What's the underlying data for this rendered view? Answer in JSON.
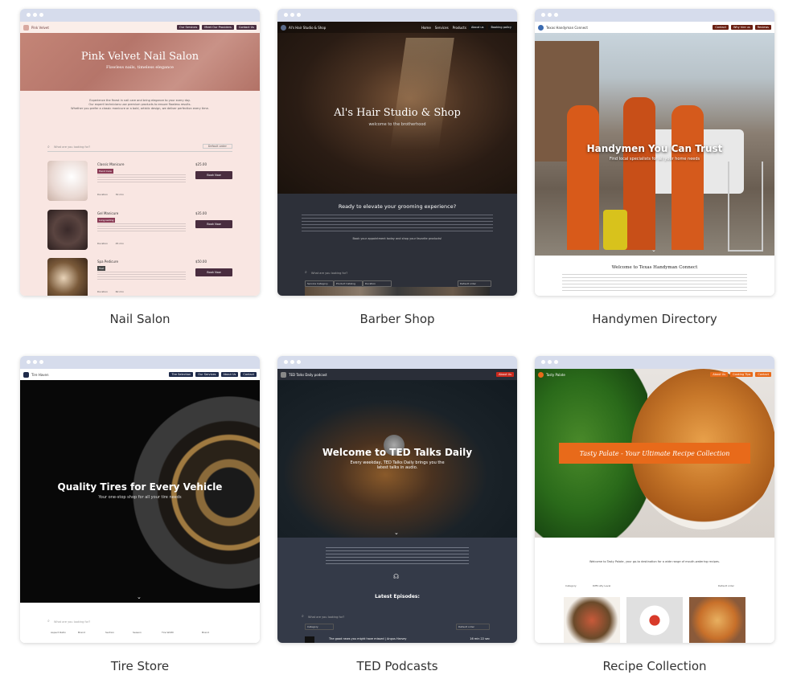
{
  "cards": [
    {
      "caption": "Nail Salon",
      "brand": "Pink Velvet",
      "nav": [
        "Our Services",
        "Meet Our Providers",
        "Contact Us"
      ],
      "hero_title": "Pink Velvet Nail Salon",
      "hero_subtitle": "Flawless nails, timeless elegance",
      "intro": [
        "Experience the finest in nail care and bring elegance to your every day.",
        "Our expert technicians use premium products to ensure flawless results.",
        "Whether you prefer a classic manicure or a bold, artistic design, we deliver perfection every time."
      ],
      "search_placeholder": "What are you looking for?",
      "sort_label": "Default order",
      "services": [
        {
          "name": "Classic Manicure",
          "tag": "Hand Care",
          "price": "$25.00",
          "duration_label": "Duration",
          "duration": "30 min",
          "cta": "Book Now"
        },
        {
          "name": "Gel Manicure",
          "tag": "Long-lasting",
          "price": "$35.00",
          "duration_label": "Duration",
          "duration": "45 min",
          "cta": "Book Now"
        },
        {
          "name": "Spa Pedicure",
          "tag": "Feet",
          "price": "$50.00",
          "duration_label": "Duration",
          "duration": "60 min",
          "cta": "Book Now"
        }
      ]
    },
    {
      "caption": "Barber Shop",
      "brand": "Al's Hair Studio & Shop",
      "nav": [
        "Home",
        "Services",
        "Products",
        "About us"
      ],
      "nav_cta": "Booking policy",
      "hero_title": "Al's Hair Studio & Shop",
      "hero_subtitle": "welcome to the brotherhood",
      "section_title": "Ready to elevate your grooming experience?",
      "section_sub": "Book your appointment today and shop your favorite products!",
      "search_placeholder": "What are you looking for?",
      "filters": [
        "Service Category",
        "Product Catalog",
        "Duration"
      ],
      "sort_label": "Default order"
    },
    {
      "caption": "Handymen Directory",
      "brand": "Texas Handyman Connect",
      "nav": [
        "Contact",
        "Why hire us",
        "Reviews"
      ],
      "nav_cta": "Find help now",
      "hero_title": "Handymen You Can Trust",
      "hero_subtitle": "Find local specialists for all your home needs",
      "section_title": "Welcome to Texas Handyman Connect"
    },
    {
      "caption": "Tire Store",
      "brand": "Tire Haven",
      "nav": [
        "Tire Selection",
        "Our Services",
        "About Us",
        "Contact"
      ],
      "hero_title": "Quality Tires for Every Vehicle",
      "hero_subtitle": "Your one-stop shop for all your tire needs",
      "search_placeholder": "What are you looking for?",
      "filters": [
        "Aspect Ratio",
        "Brand",
        "Section",
        "Season",
        "Tire Width",
        "Brand"
      ]
    },
    {
      "caption": "TED Podcasts",
      "brand": "TED Talks Daily podcast",
      "nav_cta": "About Us",
      "hero_title": "Welcome to TED Talks Daily",
      "hero_subtitle": "Every weekday, TED Talks Daily brings you the latest talks in audio.",
      "section_title": "Latest Episodes:",
      "search_placeholder": "What are you looking for?",
      "filter_label": "Category",
      "sort_label": "Default order",
      "episode_title": "The good news you might have missed | Angus Harvey",
      "episode_duration": "16 min 22 sec"
    },
    {
      "caption": "Recipe Collection",
      "brand": "Tasty Palate",
      "nav": [
        "About Us",
        "Cooking Tips",
        "Contact"
      ],
      "nav_cta": "Submit Recipe",
      "hero_title": "Tasty Palate - Your Ultimate Recipe Collection",
      "intro": "Welcome to Tasty Palate, your go-to destination for a wide range of mouth-watering recipes.",
      "filters": [
        "Category",
        "Difficulty Level"
      ],
      "sort_label": "Default order"
    }
  ],
  "colors": {
    "chrome": "#d6dcec",
    "nail_pink": "#f9e6e2",
    "nail_banner": "#c48577",
    "nail_btn": "#4a2d3f",
    "barber_bg": "#2d3039",
    "handy_btn": "#6a1f12",
    "tire_btn": "#1f2b4a",
    "ted_red": "#cc2a1e",
    "recipe_orange": "#e86a1a"
  }
}
